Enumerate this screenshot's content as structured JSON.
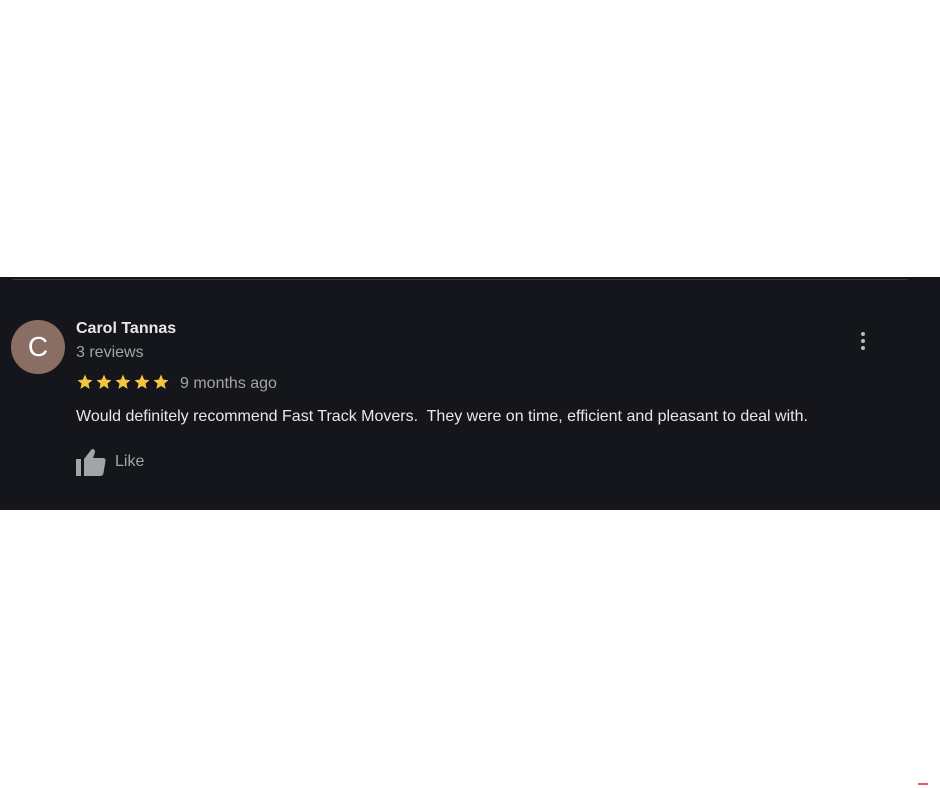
{
  "review": {
    "avatar_initial": "C",
    "avatar_color": "#8a6e63",
    "reviewer_name": "Carol Tannas",
    "review_count": "3 reviews",
    "rating": 5,
    "rating_max": 5,
    "star_color": "#f5c542",
    "time_ago": "9 months ago",
    "text": "Would definitely recommend Fast Track Movers.  They were on time, efficient and pleasant to deal with.",
    "like_label": "Like",
    "menu_icon": "more-vert-icon",
    "like_icon": "thumb-up-icon"
  },
  "colors": {
    "card_background": "#15161b",
    "page_background": "#ffffff"
  }
}
